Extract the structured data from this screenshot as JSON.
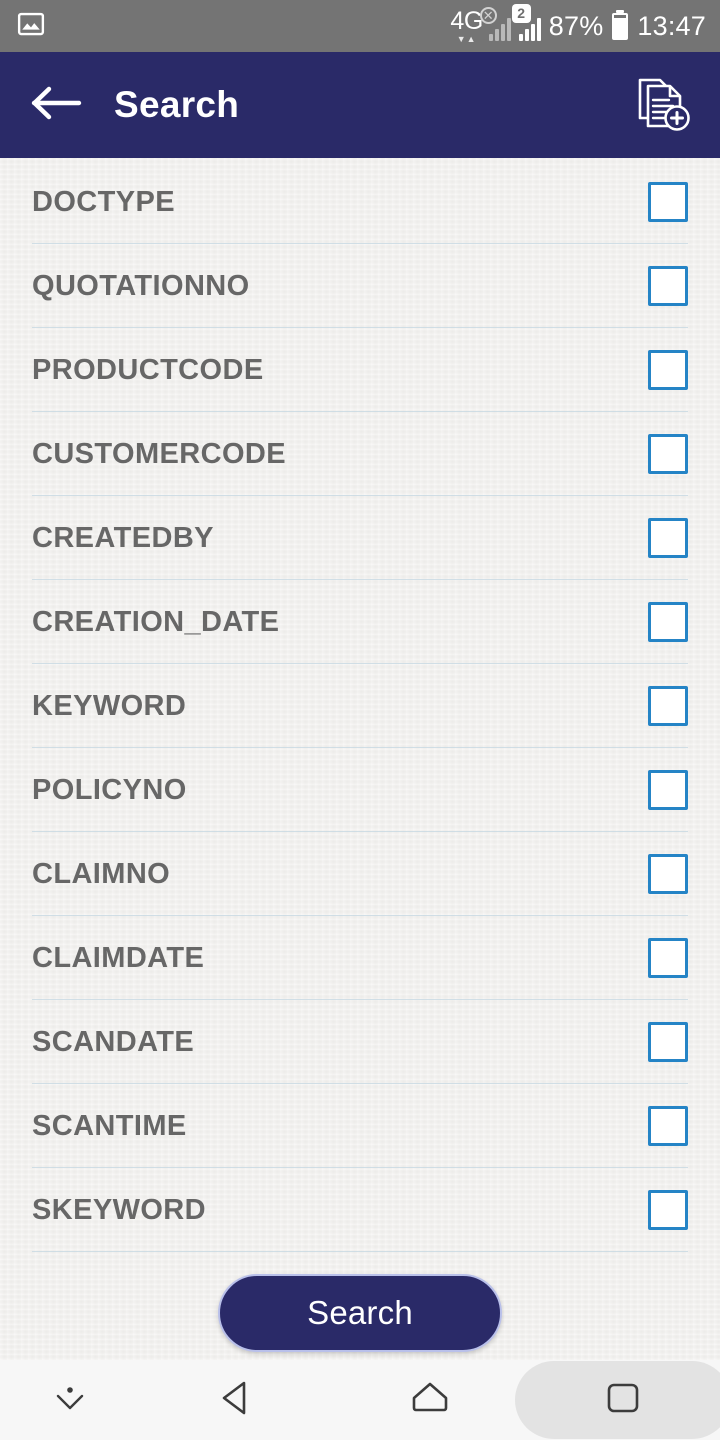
{
  "status_bar": {
    "left_icon": "image-icon",
    "network_type": "4G",
    "data_arrows": "▼▲",
    "sim1_icon": "no-sim-signal-icon",
    "sim2_badge": "2",
    "battery_percent": "87%",
    "battery_icon": "battery-icon",
    "clock": "13:47",
    "background_color": "#747474"
  },
  "app_bar": {
    "back_icon": "arrow-left-icon",
    "title": "Search",
    "action_icon": "add-document-icon",
    "background_color": "#2a2a68",
    "text_color": "#ffffff"
  },
  "search_fields": {
    "checkbox_color": "#2584c6",
    "label_color": "#676767",
    "divider_color": "#c4d7e2",
    "items": [
      {
        "label": "DOCTYPE",
        "checked": false
      },
      {
        "label": "QUOTATIONNO",
        "checked": false
      },
      {
        "label": "PRODUCTCODE",
        "checked": false
      },
      {
        "label": "CUSTOMERCODE",
        "checked": false
      },
      {
        "label": "CREATEDBY",
        "checked": false
      },
      {
        "label": "CREATION_DATE",
        "checked": false
      },
      {
        "label": "KEYWORD",
        "checked": false
      },
      {
        "label": "POLICYNO",
        "checked": false
      },
      {
        "label": "CLAIMNO",
        "checked": false
      },
      {
        "label": "CLAIMDATE",
        "checked": false
      },
      {
        "label": "SCANDATE",
        "checked": false
      },
      {
        "label": "SCANTIME",
        "checked": false
      },
      {
        "label": "SKEYWORD",
        "checked": false
      }
    ]
  },
  "search_button": {
    "label": "Search",
    "background_color": "#2a2a68",
    "border_color": "#b9c0ea",
    "text_color": "#ffffff"
  },
  "nav_bar": {
    "hide_keyboard_icon": "chevron-down-dot-icon",
    "back_icon": "triangle-back-icon",
    "home_icon": "home-icon",
    "recents_icon": "square-recents-icon",
    "background_color": "#f7f7f7"
  }
}
